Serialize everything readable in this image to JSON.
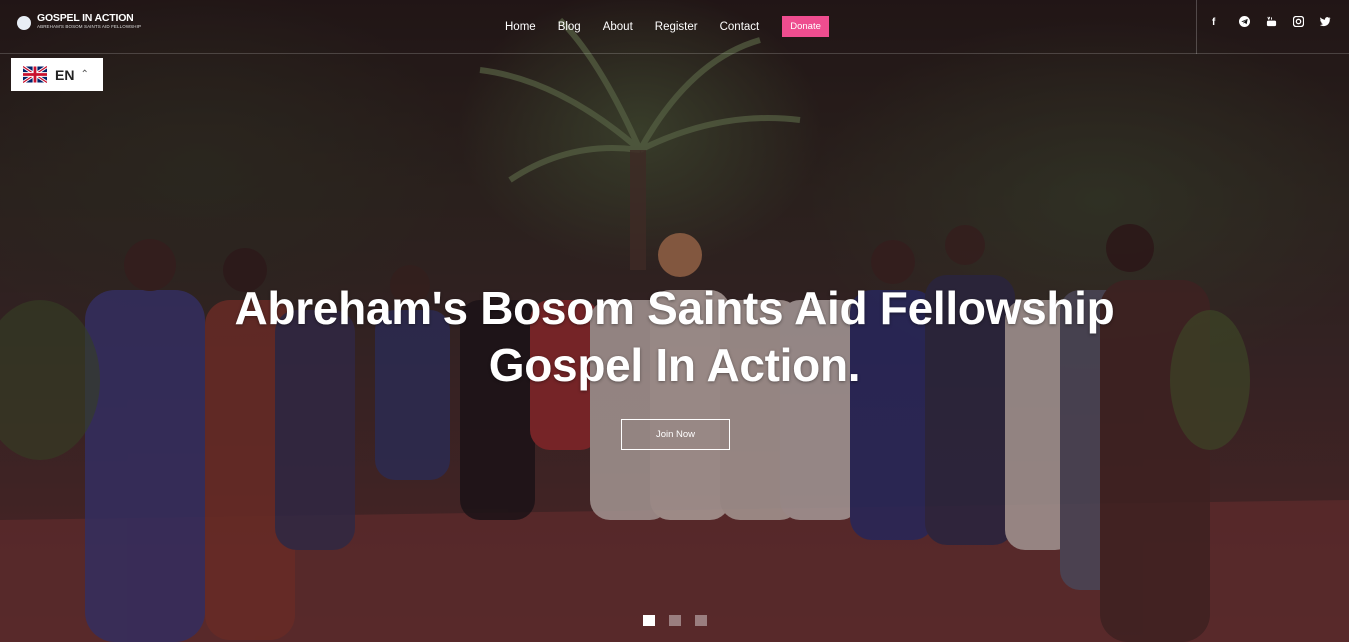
{
  "brand": {
    "title": "GOSPEL IN ACTION",
    "subtitle": "ABREHAM'S BOSOM SAINTS AID FELLOWSHIP"
  },
  "nav": {
    "items": [
      "Home",
      "Blog",
      "About",
      "Register",
      "Contact"
    ],
    "donate_label": "Donate"
  },
  "social": {
    "icons": [
      "facebook-icon",
      "telegram-icon",
      "youtube-icon",
      "instagram-icon",
      "twitter-icon"
    ]
  },
  "language": {
    "code": "EN"
  },
  "hero": {
    "line1": "Abreham's Bosom Saints Aid Fellowship",
    "line2": "Gospel In Action.",
    "cta_label": "Join Now"
  },
  "slider": {
    "slide_count": 3,
    "active_index": 0
  },
  "colors": {
    "donate": "#ee4d8f",
    "text": "#ffffff"
  }
}
